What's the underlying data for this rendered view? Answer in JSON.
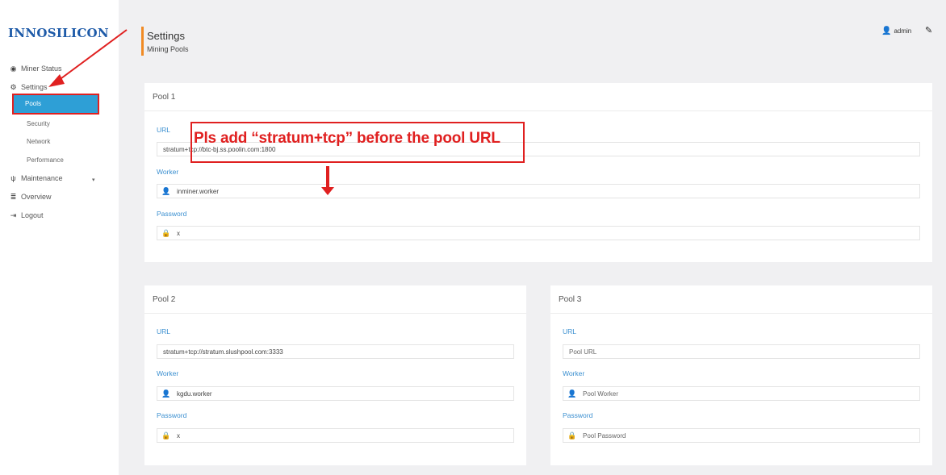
{
  "brand": {
    "logo_text": "INNOSILICON"
  },
  "sidebar": {
    "items": [
      {
        "label": "Miner Status",
        "icon": "dashboard-icon"
      },
      {
        "label": "Settings",
        "icon": "gears-icon"
      },
      {
        "label": "Maintenance",
        "icon": "plug-icon"
      },
      {
        "label": "Overview",
        "icon": "server-icon"
      },
      {
        "label": "Logout",
        "icon": "logout-icon"
      }
    ],
    "settings_sub": [
      "Pools",
      "Security",
      "Network",
      "Performance"
    ]
  },
  "header": {
    "title": "Settings",
    "subtitle": "Mining Pools",
    "user": "admin"
  },
  "labels": {
    "url": "URL",
    "worker": "Worker",
    "password": "Password"
  },
  "pools": [
    {
      "title": "Pool 1",
      "url": "stratum+tcp://btc-bj.ss.poolin.com:1800",
      "worker": "inminer.worker",
      "password": "x"
    },
    {
      "title": "Pool 2",
      "url": "stratum+tcp://stratum.slushpool.com:3333",
      "worker": "kgdu.worker",
      "password": "x"
    },
    {
      "title": "Pool 3",
      "url_placeholder": "Pool URL",
      "worker_placeholder": "Pool Worker",
      "password_placeholder": "Pool Password"
    }
  ],
  "annotation": {
    "text": "Pls add “stratum+tcp” before the pool URL",
    "color": "#e02020"
  },
  "colors": {
    "accent": "#2e9fd6",
    "label_blue": "#3a8fd0",
    "header_bar": "#f08a24"
  }
}
